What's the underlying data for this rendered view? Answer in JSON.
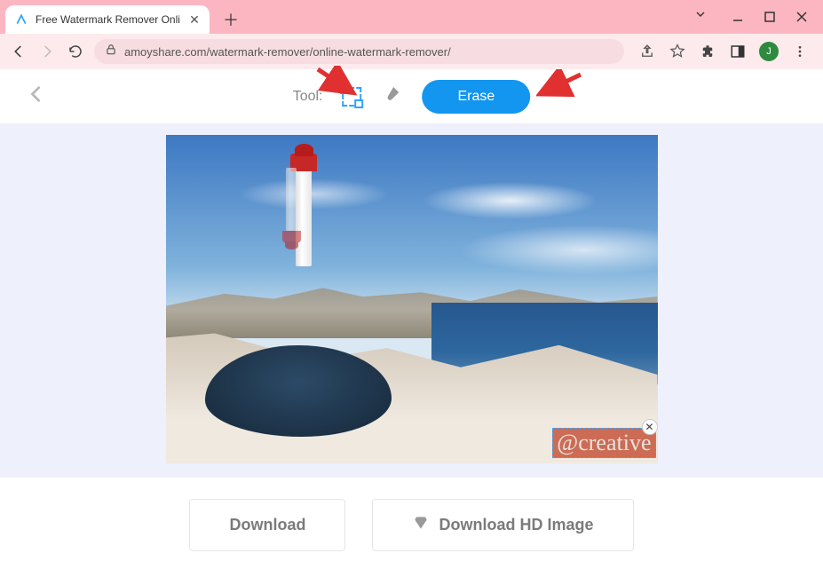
{
  "browser": {
    "tab_title": "Free Watermark Remover Onli",
    "url": "amoyshare.com/watermark-remover/online-watermark-remover/",
    "avatar_initial": "J"
  },
  "toolbar": {
    "tool_label": "Tool:",
    "erase_label": "Erase"
  },
  "image": {
    "watermark_text": "@creative"
  },
  "footer": {
    "download_label": "Download",
    "download_hd_label": "Download HD Image"
  }
}
